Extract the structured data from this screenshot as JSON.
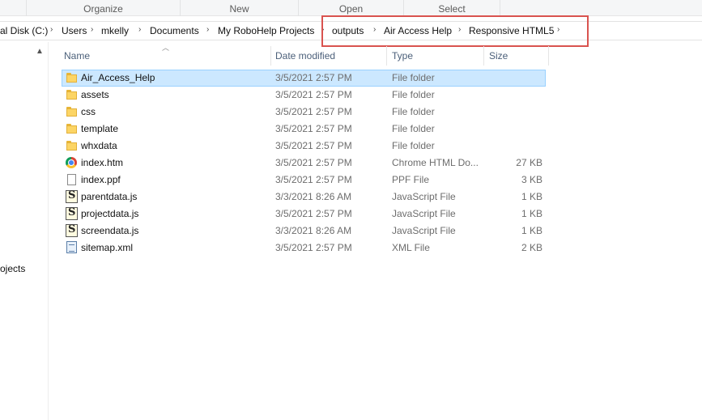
{
  "ribbon": {
    "groups": [
      "Organize",
      "New",
      "Open",
      "Select"
    ]
  },
  "address": {
    "crumbs": [
      "al Disk (C:)",
      "Users",
      "mkelly",
      "Documents",
      "My RoboHelp Projects",
      "outputs",
      "Air Access Help",
      "Responsive HTML5"
    ]
  },
  "nav": {
    "item_partial": "ojects"
  },
  "columns": {
    "name": "Name",
    "date": "Date modified",
    "type": "Type",
    "size": "Size"
  },
  "files": [
    {
      "icon": "folder-icon",
      "name": "Air_Access_Help",
      "date": "3/5/2021 2:57 PM",
      "type": "File folder",
      "size": "",
      "selected": true
    },
    {
      "icon": "folder-icon",
      "name": "assets",
      "date": "3/5/2021 2:57 PM",
      "type": "File folder",
      "size": ""
    },
    {
      "icon": "folder-icon",
      "name": "css",
      "date": "3/5/2021 2:57 PM",
      "type": "File folder",
      "size": ""
    },
    {
      "icon": "folder-icon",
      "name": "template",
      "date": "3/5/2021 2:57 PM",
      "type": "File folder",
      "size": ""
    },
    {
      "icon": "folder-icon",
      "name": "whxdata",
      "date": "3/5/2021 2:57 PM",
      "type": "File folder",
      "size": ""
    },
    {
      "icon": "chrome-icon",
      "name": "index.htm",
      "date": "3/5/2021 2:57 PM",
      "type": "Chrome HTML Do...",
      "size": "27 KB"
    },
    {
      "icon": "document-icon",
      "name": "index.ppf",
      "date": "3/5/2021 2:57 PM",
      "type": "PPF File",
      "size": "3 KB"
    },
    {
      "icon": "javascript-file-icon",
      "name": "parentdata.js",
      "date": "3/3/2021 8:26 AM",
      "type": "JavaScript File",
      "size": "1 KB"
    },
    {
      "icon": "javascript-file-icon",
      "name": "projectdata.js",
      "date": "3/5/2021 2:57 PM",
      "type": "JavaScript File",
      "size": "1 KB"
    },
    {
      "icon": "javascript-file-icon",
      "name": "screendata.js",
      "date": "3/3/2021 8:26 AM",
      "type": "JavaScript File",
      "size": "1 KB"
    },
    {
      "icon": "xml-file-icon",
      "name": "sitemap.xml",
      "date": "3/5/2021 2:57 PM",
      "type": "XML File",
      "size": "2 KB"
    }
  ],
  "colors": {
    "selection_bg": "#cce8ff",
    "highlight_border": "#d9534f",
    "header_text": "#4c607a"
  }
}
